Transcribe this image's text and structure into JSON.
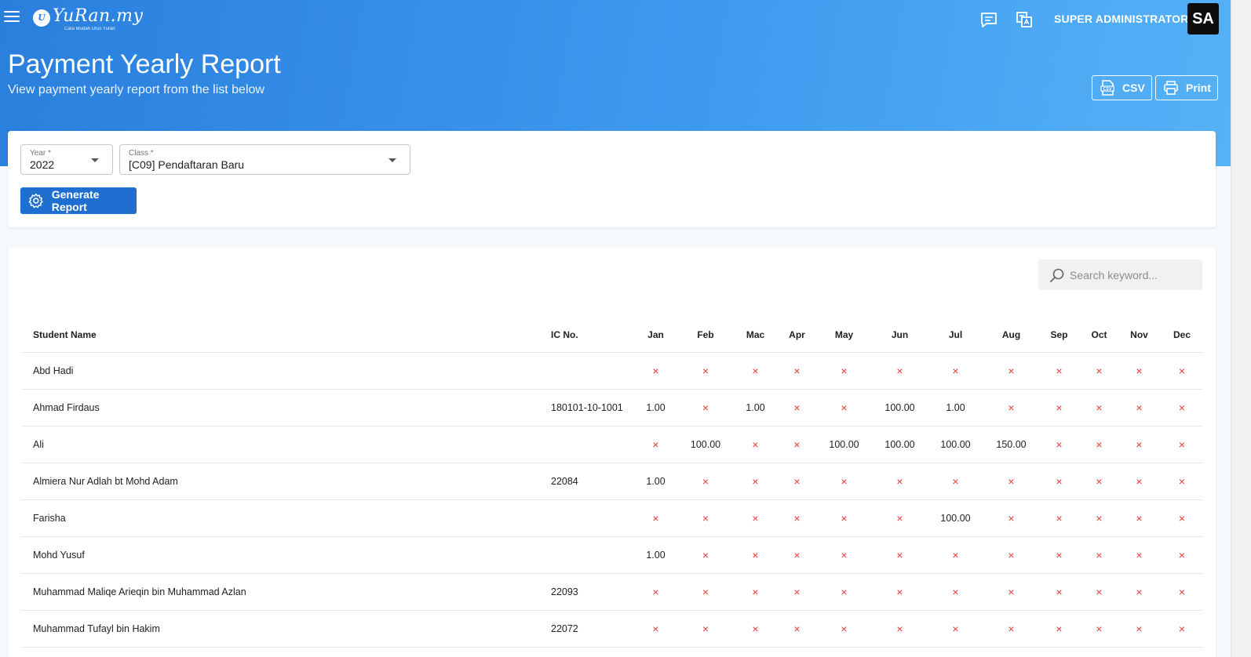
{
  "header": {
    "logo_mark": "U",
    "logo_text": "YuRan.my",
    "logo_tagline": "Cara Mudah Urus Yuran",
    "user_name": "SUPER ADMINISTRATOR",
    "avatar_initials": "SA"
  },
  "page": {
    "title": "Payment Yearly Report",
    "subtitle": "View payment yearly report from the list below",
    "csv_label": "CSV",
    "print_label": "Print"
  },
  "filters": {
    "year_label": "Year *",
    "year_value": "2022",
    "class_label": "Class *",
    "class_value": "[C09] Pendaftaran Baru",
    "generate_label": "Generate Report"
  },
  "search": {
    "placeholder": "Search keyword..."
  },
  "table": {
    "columns": [
      "Student Name",
      "IC No.",
      "Jan",
      "Feb",
      "Mac",
      "Apr",
      "May",
      "Jun",
      "Jul",
      "Aug",
      "Sep",
      "Oct",
      "Nov",
      "Dec"
    ],
    "unpaid_symbol": "×",
    "rows": [
      {
        "name": "Abd Hadi",
        "ic": "",
        "months": [
          "",
          "",
          "",
          "",
          "",
          "",
          "",
          "",
          "",
          "",
          "",
          ""
        ]
      },
      {
        "name": "Ahmad Firdaus",
        "ic": "180101-10-1001",
        "months": [
          "1.00",
          "",
          "1.00",
          "",
          "",
          "100.00",
          "1.00",
          "",
          "",
          "",
          "",
          ""
        ]
      },
      {
        "name": "Ali",
        "ic": "",
        "months": [
          "",
          "100.00",
          "",
          "",
          "100.00",
          "100.00",
          "100.00",
          "150.00",
          "",
          "",
          "",
          ""
        ]
      },
      {
        "name": "Almiera Nur Adlah bt Mohd Adam",
        "ic": "22084",
        "months": [
          "1.00",
          "",
          "",
          "",
          "",
          "",
          "",
          "",
          "",
          "",
          "",
          ""
        ]
      },
      {
        "name": "Farisha",
        "ic": "",
        "months": [
          "",
          "",
          "",
          "",
          "",
          "",
          "100.00",
          "",
          "",
          "",
          "",
          ""
        ]
      },
      {
        "name": "Mohd Yusuf",
        "ic": "",
        "months": [
          "1.00",
          "",
          "",
          "",
          "",
          "",
          "",
          "",
          "",
          "",
          "",
          ""
        ]
      },
      {
        "name": "Muhammad Maliqe Arieqin bin Muhammad Azlan",
        "ic": "22093",
        "months": [
          "",
          "",
          "",
          "",
          "",
          "",
          "",
          "",
          "",
          "",
          "",
          ""
        ]
      },
      {
        "name": "Muhammad Tufayl bin Hakim",
        "ic": "22072",
        "months": [
          "",
          "",
          "",
          "",
          "",
          "",
          "",
          "",
          "",
          "",
          "",
          ""
        ]
      }
    ]
  }
}
